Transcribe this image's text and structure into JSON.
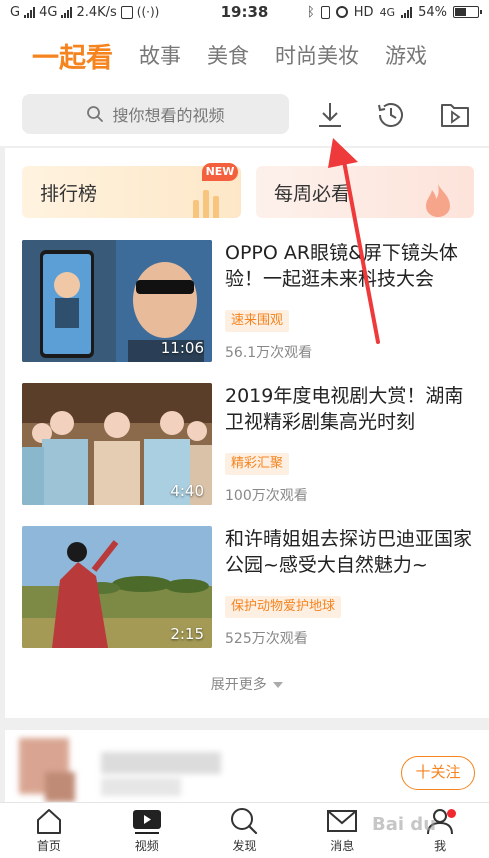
{
  "status_bar": {
    "carrier_left": "G",
    "network": "4G",
    "speed": "2.4K/s",
    "time": "19:38",
    "hd": "HD",
    "network_right": "4G",
    "battery": "54%"
  },
  "top_tabs": [
    {
      "label": "一起看",
      "active": true
    },
    {
      "label": "故事",
      "active": false
    },
    {
      "label": "美食",
      "active": false
    },
    {
      "label": "时尚美妆",
      "active": false
    },
    {
      "label": "游戏",
      "active": false
    }
  ],
  "search": {
    "placeholder": "搜你想看的视频"
  },
  "banners": {
    "rank_label": "排行榜",
    "rank_badge": "NEW",
    "weekly_label": "每周必看"
  },
  "videos": [
    {
      "title": "OPPO AR眼镜&屏下镜头体验！一起逛未来科技大会",
      "tag": "速来围观",
      "views": "56.1万次观看",
      "duration": "11:06"
    },
    {
      "title": "2019年度电视剧大赏！湖南卫视精彩剧集高光时刻",
      "tag": "精彩汇聚",
      "views": "100万次观看",
      "duration": "4:40"
    },
    {
      "title": "和许晴姐姐去探访巴迪亚国家公园~感受大自然魅力~",
      "tag": "保护动物爱护地球",
      "views": "525万次观看",
      "duration": "2:15"
    }
  ],
  "expand_more": "展开更多",
  "follow_button": "十关注",
  "bottom_nav": [
    {
      "label": "首页",
      "icon": "home-icon"
    },
    {
      "label": "视频",
      "icon": "video-icon"
    },
    {
      "label": "发现",
      "icon": "search-icon"
    },
    {
      "label": "消息",
      "icon": "mail-icon"
    },
    {
      "label": "我",
      "icon": "user-icon"
    }
  ],
  "watermark": "Bai du",
  "colors": {
    "accent": "#f5841f",
    "badge_red": "#f4603d",
    "annotation_arrow": "#ee3a3a"
  }
}
